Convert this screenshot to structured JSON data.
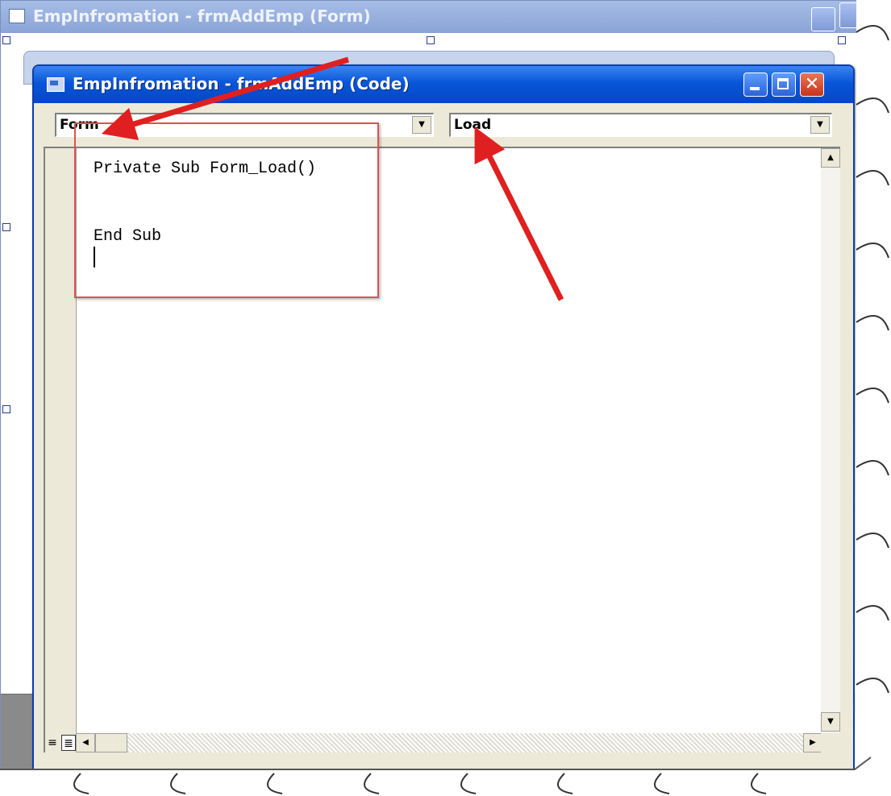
{
  "background_window": {
    "title": "EmpInfromation - frmAddEmp (Form)"
  },
  "code_window": {
    "title": "EmpInfromation - frmAddEmp (Code)",
    "object_combo": {
      "value": "Form"
    },
    "procedure_combo": {
      "value": "Load"
    },
    "code_lines": [
      "Private Sub Form_Load()",
      "",
      "",
      "End Sub"
    ]
  },
  "annotations": {
    "arrow_color": "#e02020",
    "highlight_color": "#e05050"
  },
  "icons": {
    "min": "minimize-icon",
    "max": "maximize-icon",
    "close": "close-icon",
    "close_glyph": "✕",
    "down_arrow": "▼",
    "up_arrow": "▲",
    "left_arrow": "◀",
    "right_arrow": "▶",
    "view_proc_glyph": "≡",
    "view_full_glyph": "≣"
  }
}
